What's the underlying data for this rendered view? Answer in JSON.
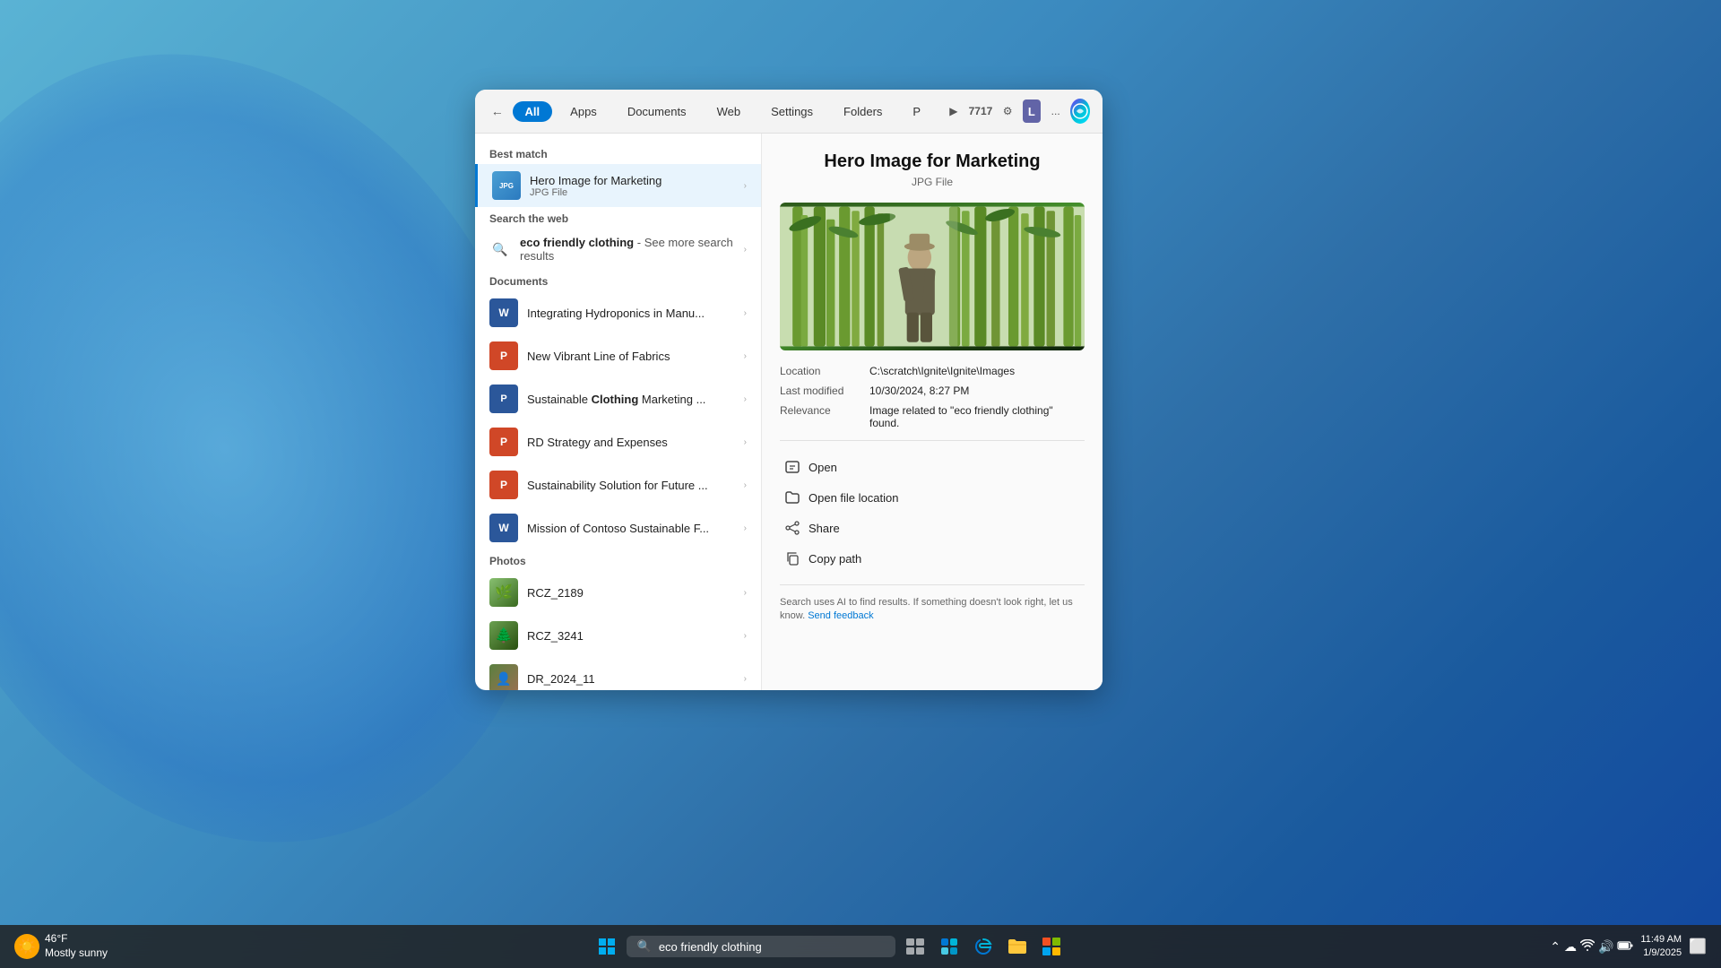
{
  "background": {
    "description": "Windows 11 blue bloom background"
  },
  "topbar": {
    "tabs": [
      {
        "id": "all",
        "label": "All",
        "active": true
      },
      {
        "id": "apps",
        "label": "Apps",
        "active": false
      },
      {
        "id": "documents",
        "label": "Documents",
        "active": false
      },
      {
        "id": "web",
        "label": "Web",
        "active": false
      },
      {
        "id": "settings",
        "label": "Settings",
        "active": false
      },
      {
        "id": "folders",
        "label": "Folders",
        "active": false
      },
      {
        "id": "p",
        "label": "P",
        "active": false
      }
    ],
    "play_btn": "▶",
    "count": "7717",
    "user_badge": "L",
    "more": "..."
  },
  "sections": {
    "best_match": {
      "label": "Best match",
      "items": [
        {
          "name": "Hero Image for Marketing",
          "subtitle": "JPG File",
          "type": "jpg",
          "selected": true
        }
      ]
    },
    "search_the_web": {
      "label": "Search the web",
      "query": "eco friendly clothing",
      "suffix": "- See more search results"
    },
    "documents": {
      "label": "Documents",
      "items": [
        {
          "name": "Integrating Hydroponics in Manu...",
          "type": "word"
        },
        {
          "name": "New Vibrant Line of Fabrics",
          "type": "ppt"
        },
        {
          "name": "Sustainable Clothing Marketing ...",
          "type": "pptx_blue"
        },
        {
          "name": "RD Strategy and Expenses",
          "type": "ppt"
        },
        {
          "name": "Sustainability Solution for Future ...",
          "type": "ppt"
        },
        {
          "name": "Mission of Contoso Sustainable F...",
          "type": "word"
        }
      ]
    },
    "photos": {
      "label": "Photos",
      "items": [
        {
          "name": "RCZ_2189",
          "type": "photo_green"
        },
        {
          "name": "RCZ_3241",
          "type": "photo_green2"
        },
        {
          "name": "DR_2024_11",
          "type": "photo_person"
        }
      ]
    }
  },
  "preview": {
    "title": "Hero Image for Marketing",
    "file_type": "JPG File",
    "location_label": "Location",
    "location_value": "C:\\scratch\\Ignite\\Ignite\\Images",
    "last_modified_label": "Last modified",
    "last_modified_value": "10/30/2024, 8:27 PM",
    "relevance_label": "Relevance",
    "relevance_value": "Image related to \"eco friendly clothing\" found.",
    "actions": [
      {
        "id": "open",
        "label": "Open",
        "icon": "↗"
      },
      {
        "id": "open-file-location",
        "label": "Open file location",
        "icon": "📁"
      },
      {
        "id": "share",
        "label": "Share",
        "icon": "⤴"
      },
      {
        "id": "copy-path",
        "label": "Copy path",
        "icon": "📋"
      }
    ],
    "ai_footer": "Search uses AI to find results. If something doesn't look right, let us know.",
    "send_feedback": "Send feedback"
  },
  "taskbar": {
    "weather_temp": "46°F",
    "weather_desc": "Mostly sunny",
    "search_placeholder": "eco friendly clothing",
    "time": "11:49 AM",
    "date": "1/9/2025"
  }
}
